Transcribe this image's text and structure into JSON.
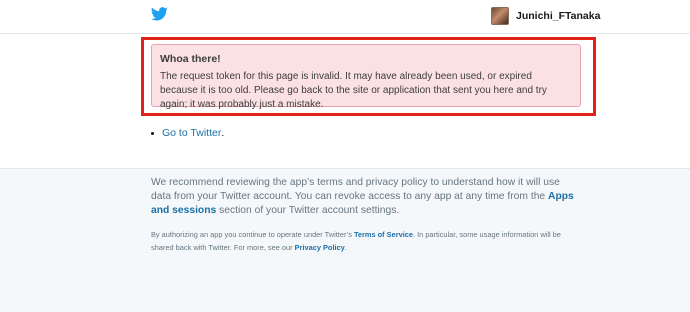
{
  "header": {
    "logo_icon": "twitter-bird-icon",
    "brand_color": "#1da1f2",
    "username": "Junichi_FTanaka"
  },
  "alert": {
    "title": "Whoa there!",
    "message": "The request token for this page is invalid. It may have already been used, or expired because it is too old. Please go back to the site or application that sent you here and try again; it was probably just a mistake.",
    "background_color": "#fbe1e4",
    "highlight_color": "#e2231a"
  },
  "links": {
    "go_to_twitter": "Go to Twitter",
    "trailing_period": "."
  },
  "footer": {
    "main_text_1": "We recommend reviewing the app’s terms and privacy policy to understand how it will use data from your Twitter account. You can revoke access to any app at any time from the ",
    "apps_sessions_link": "Apps and sessions",
    "main_text_2": " section of your Twitter account settings.",
    "small_text_1": "By authorizing an app you continue to operate under Twitter’s ",
    "terms_link": "Terms of Service",
    "small_text_2": ". In particular, some usage information will be shared back with Twitter. For more, see our ",
    "privacy_link": "Privacy Policy",
    "small_text_3": "."
  }
}
